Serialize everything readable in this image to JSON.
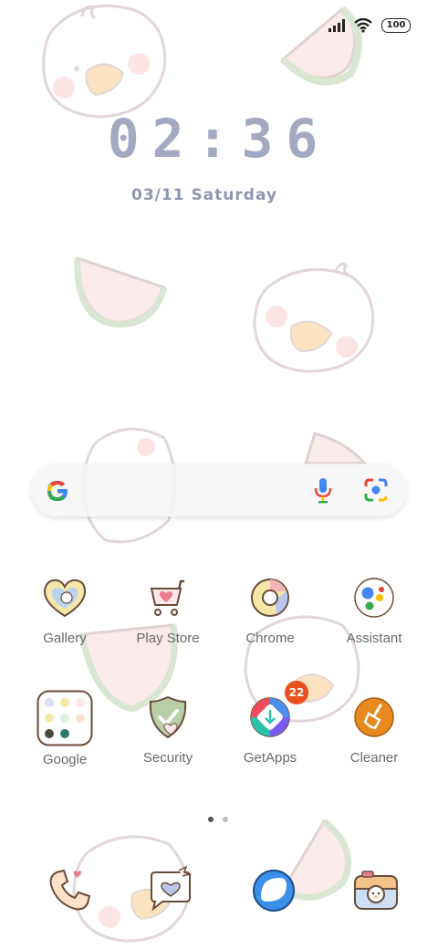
{
  "status": {
    "battery_level": "100",
    "signal_icon": "signal-icon",
    "wifi_icon": "wifi-icon"
  },
  "lockclock": {
    "time": "02:36",
    "date": "03/11 Saturday"
  },
  "search": {
    "google_icon": "google-g-icon",
    "mic_icon": "mic-icon",
    "lens_icon": "lens-icon"
  },
  "apps_row1": [
    {
      "label": "Gallery",
      "icon": "gallery-icon"
    },
    {
      "label": "Play Store",
      "icon": "play-store-icon"
    },
    {
      "label": "Chrome",
      "icon": "chrome-icon"
    },
    {
      "label": "Assistant",
      "icon": "assistant-icon"
    }
  ],
  "apps_row2": [
    {
      "label": "Google",
      "icon": "google-folder-icon"
    },
    {
      "label": "Security",
      "icon": "security-icon"
    },
    {
      "label": "GetApps",
      "icon": "getapps-icon",
      "badge": "22"
    },
    {
      "label": "Cleaner",
      "icon": "cleaner-icon"
    }
  ],
  "page_indicator": {
    "pages": 2,
    "current": 1
  },
  "dock": [
    {
      "icon": "phone-icon"
    },
    {
      "icon": "messages-icon"
    },
    {
      "icon": "browser-icon"
    },
    {
      "icon": "camera-icon"
    }
  ],
  "colors": {
    "clock": "#a3a9c2",
    "badge": "#e8501f",
    "cleaner": "#e8891f"
  }
}
